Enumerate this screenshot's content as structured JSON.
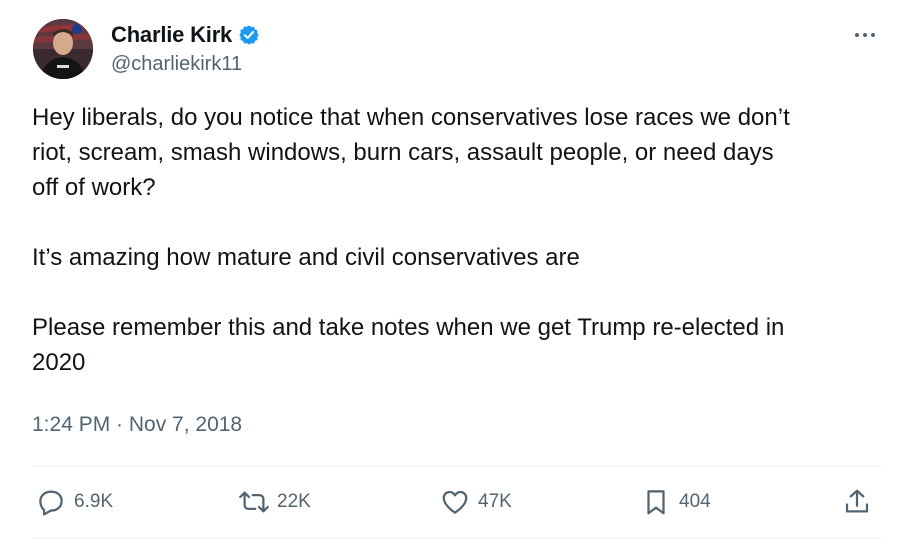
{
  "author": {
    "name": "Charlie Kirk",
    "handle": "@charliekirk11",
    "verified_color": "#1d9bf0"
  },
  "tweet": {
    "paragraph1_line1": "Hey liberals, do you notice that when conservatives lose races we don’t",
    "paragraph1_line2": "riot, scream, smash windows, burn cars, assault people, or need days",
    "paragraph1_line3": "off of work?",
    "paragraph2": "It’s amazing how mature and civil conservatives are",
    "paragraph3_line1": "Please remember this and take notes when we get Trump re-elected in",
    "paragraph3_line2": "2020",
    "timestamp": "1:24 PM · Nov 7, 2018"
  },
  "actions": {
    "replies": "6.9K",
    "retweets": "22K",
    "likes": "47K",
    "bookmarks": "404"
  },
  "icons": [
    "more-icon",
    "verified-badge-icon",
    "reply-icon",
    "retweet-icon",
    "like-icon",
    "bookmark-icon",
    "share-icon"
  ]
}
